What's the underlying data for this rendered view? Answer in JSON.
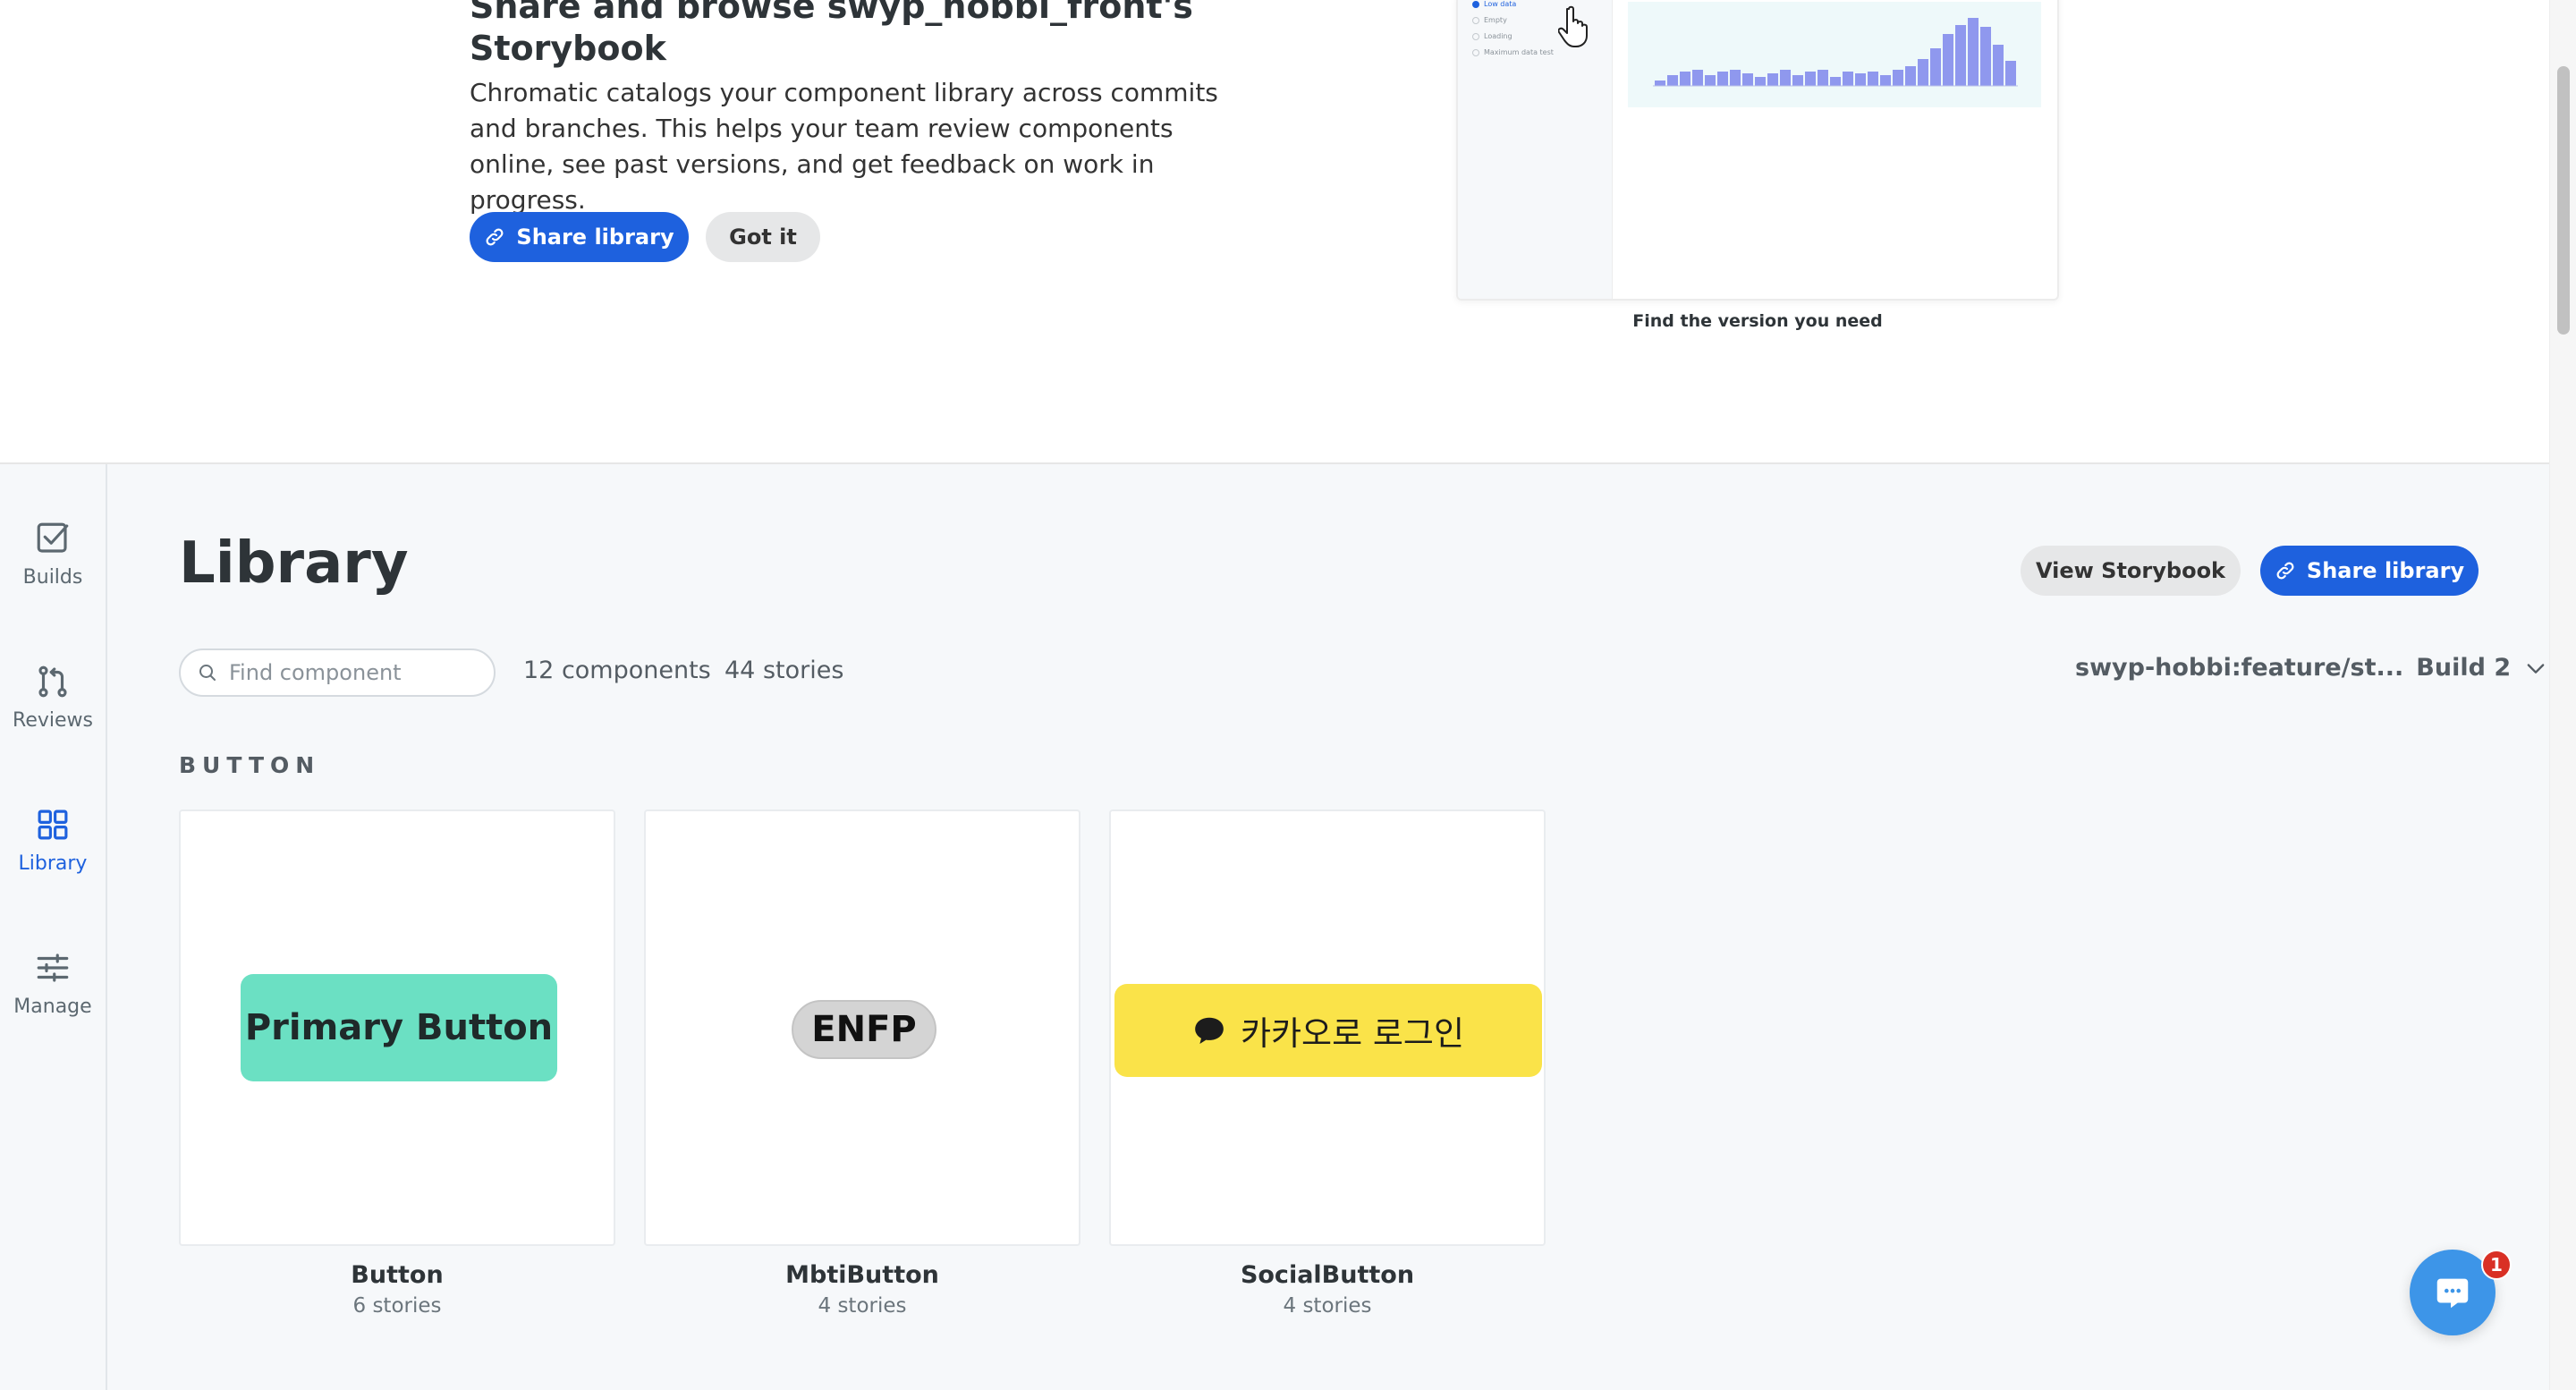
{
  "banner": {
    "title": "Share and browse swyp_hobbi_front's Storybook",
    "description": "Chromatic catalogs your component library across commits and branches. This helps your team review components online, see past versions, and get feedback on work in progress.",
    "share_label": "Share library",
    "got_it_label": "Got it",
    "preview_items": [
      "Low data",
      "Empty",
      "Loading",
      "Maximum data test"
    ],
    "preview_caption": "Find the version you need"
  },
  "sidenav": {
    "items": [
      {
        "label": "Builds",
        "icon": "checkbox-icon"
      },
      {
        "label": "Reviews",
        "icon": "pull-request-icon"
      },
      {
        "label": "Library",
        "icon": "grid-icon"
      },
      {
        "label": "Manage",
        "icon": "sliders-icon"
      }
    ],
    "active": "Library"
  },
  "library": {
    "title": "Library",
    "view_storybook_label": "View Storybook",
    "share_label": "Share library",
    "search_placeholder": "Find component",
    "component_count": "12 components",
    "story_count": "44 stories",
    "branch": "swyp-hobbi:feature/st...",
    "build": "Build 2",
    "section": "BUTTON",
    "components": [
      {
        "name": "Button",
        "stories": "6 stories",
        "preview_text": "Primary Button"
      },
      {
        "name": "MbtiButton",
        "stories": "4 stories",
        "preview_text": "ENFP"
      },
      {
        "name": "SocialButton",
        "stories": "4 stories",
        "preview_text": "카카오로 로그인"
      }
    ]
  },
  "chat": {
    "badge": "1"
  },
  "colors": {
    "accent": "#1e61de",
    "primary_button_preview": "#6be0c3",
    "kakao_yellow": "#fae349",
    "chat_blue": "#3d95e8"
  }
}
